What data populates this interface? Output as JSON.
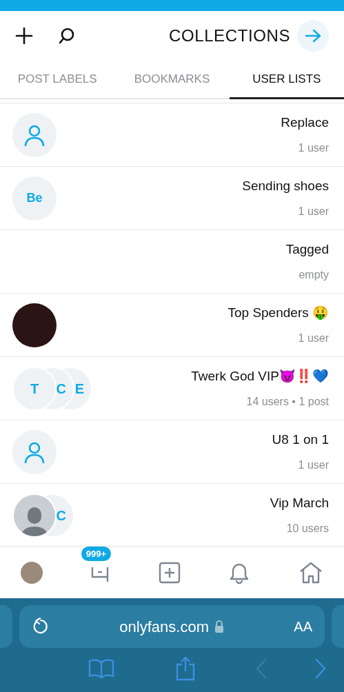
{
  "header": {
    "title": "COLLECTIONS"
  },
  "tabs": [
    {
      "label": "POST LABELS",
      "selected": false
    },
    {
      "label": "BOOKMARKS",
      "selected": false
    },
    {
      "label": "USER LISTS",
      "selected": true
    }
  ],
  "lists": [
    {
      "name": "Replace",
      "meta": "1 user",
      "avatar": {
        "kind": "person"
      }
    },
    {
      "name": "Sending shoes",
      "meta": "1 user",
      "avatar": {
        "kind": "initials",
        "text": "Be"
      }
    },
    {
      "name": "Tagged",
      "meta": "empty",
      "avatar": {
        "kind": "none"
      }
    },
    {
      "name": "Top Spenders 🤑",
      "meta": "1 user",
      "avatar": {
        "kind": "photo"
      }
    },
    {
      "name": "Twerk God VIP😈‼️💙",
      "meta": "14 users • 1 post",
      "avatar": {
        "kind": "stack",
        "letters": [
          "T",
          "C",
          "E"
        ]
      }
    },
    {
      "name": "U8 1 on 1",
      "meta": "1 user",
      "avatar": {
        "kind": "person"
      }
    },
    {
      "name": "Vip March",
      "meta": "10 users",
      "avatar": {
        "kind": "silhouette-stack",
        "letters": [
          "C"
        ]
      }
    }
  ],
  "bottom_nav": {
    "badge": "999+"
  },
  "browser": {
    "text_size": "AA",
    "url": "onlyfans.com"
  }
}
